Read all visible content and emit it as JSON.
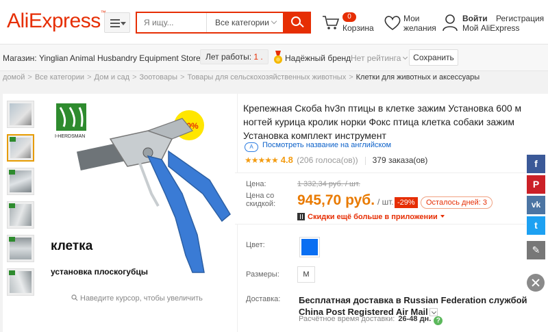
{
  "header": {
    "logo": "AliExpress",
    "logo_tm": "™",
    "search_placeholder": "Я ищу...",
    "category_select": "Все категории",
    "cart_count": "0",
    "cart_label": "Корзина",
    "wishlist_line1": "Мои",
    "wishlist_line2": "желания",
    "login_label": "Войти",
    "register_label": "Регистрация",
    "my_account_label": "Мой AliExpress"
  },
  "store": {
    "label": "Магазин:",
    "name": "Yinglian Animal Husbandry Equipment Store",
    "years_label": "Лет работы:",
    "years_value": "1 .",
    "brand_label": "Надёжный бренд",
    "rating_label": "Нет рейтинга",
    "save_button": "Сохранить"
  },
  "breadcrumb": [
    "домой",
    "Все категории",
    "Дом и сад",
    "Зоотовары",
    "Товары для сельскохозяйственных животных",
    "Клетки для животных и аксессуары"
  ],
  "gallery": {
    "brand_text": "I-HERDSMAN",
    "badge": "100%",
    "overlay_line1": "клетка",
    "overlay_line2": "установка плоскогубцы",
    "zoom_hint": "Наведите курсор, чтобы увеличить",
    "thumb_count": 6
  },
  "product": {
    "title": "Крепежная Скоба hv3n птицы в клетке зажим Установка 600 м ногтей курица кролик норки Фокс птица клетка собаки зажим Установка комплект инструмент",
    "translate_link": "Посмотреть название на английском",
    "translate_icon": "A",
    "stars": "★★★★★",
    "rating": "4.8",
    "votes": "(206 голоса(ов))",
    "orders": "379 заказа(ов)"
  },
  "price": {
    "price_label": "Цена:",
    "discount_label_line1": "Цена со",
    "discount_label_line2": "скидкой:",
    "old_price": "1 332,34 руб. / шт.",
    "new_price": "945,70 руб.",
    "unit": "/ шт.",
    "discount": "-29%",
    "days_left": "Осталось дней: 3",
    "app_discount": "Скидки ещё больше в приложении"
  },
  "options": {
    "color_label": "Цвет:",
    "color_value": "#0a6ff2",
    "size_label": "Размеры:",
    "size_value": "M",
    "shipping_label": "Доставка:",
    "shipping_text": "Бесплатная доставка в Russian Federation службой China Post Registered Air Mail",
    "eta_label": "Расчётное время доставки:",
    "eta_value": "26-48 дн.",
    "eta_help": "?"
  },
  "social": [
    {
      "name": "facebook",
      "glyph": "f",
      "color": "#3b5998"
    },
    {
      "name": "pinterest",
      "glyph": "P",
      "color": "#cb2027"
    },
    {
      "name": "vk",
      "glyph": "vk",
      "color": "#4c75a3"
    },
    {
      "name": "twitter",
      "glyph": "t",
      "color": "#1da1f2"
    },
    {
      "name": "edit",
      "glyph": "✎",
      "color": "#777777"
    }
  ],
  "colors": {
    "brand_red": "#e62e04",
    "price_orange": "#e97a00",
    "link_blue": "#0c61c9"
  }
}
